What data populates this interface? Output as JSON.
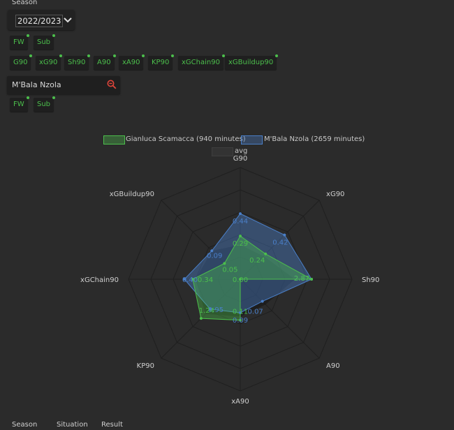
{
  "controls": {
    "season_label": "Season",
    "season_value": "2022/2023",
    "position_filters": [
      {
        "label": "FW"
      },
      {
        "label": "Sub"
      }
    ],
    "metric_filters": [
      {
        "label": "G90"
      },
      {
        "label": "xG90"
      },
      {
        "label": "Sh90"
      },
      {
        "label": "A90"
      },
      {
        "label": "xA90"
      },
      {
        "label": "KP90"
      },
      {
        "label": "xGChain90"
      },
      {
        "label": "xGBuildup90"
      }
    ],
    "player_search_value": "M'Bala Nzola",
    "player_position_filters": [
      {
        "label": "FW"
      },
      {
        "label": "Sub"
      }
    ]
  },
  "colors": {
    "green": "#4cbf4c",
    "blue": "#4a7fc8"
  },
  "chart_data": {
    "type": "radar",
    "axes": [
      "G90",
      "xG90",
      "Sh90",
      "A90",
      "xA90",
      "KP90",
      "xGChain90",
      "xGBuildup90"
    ],
    "series": [
      {
        "name": "Gianluca Scamacca (940 minutes)",
        "color": "#4cbf4c",
        "values": [
          0.29,
          0.24,
          2.87,
          0.0,
          0.11,
          1.24,
          0.34,
          0.05
        ]
      },
      {
        "name": "M'Bala Nzola (2659 minutes)",
        "color": "#4a7fc8",
        "values": [
          0.44,
          0.42,
          2.87,
          0.07,
          0.09,
          0.95,
          0.4,
          0.09
        ]
      },
      {
        "name": "avg",
        "color": "#3a3a3a",
        "values": [
          0.23,
          0.22,
          2.2,
          0.08,
          0.1,
          1.1,
          0.32,
          0.09
        ]
      }
    ],
    "axis_max": [
      0.75,
      0.75,
      4.5,
      0.25,
      0.3,
      2.5,
      0.8,
      0.25
    ],
    "labels": {
      "green": [
        "0.29",
        "0.24",
        "2.87",
        "0.00",
        "0.11",
        "1.24",
        "0.34",
        "0.05"
      ],
      "blue": [
        "0.44",
        "0.42",
        "2.87",
        "0.07",
        "0.09",
        "0.95",
        "0.40",
        "0.09"
      ]
    },
    "grid_levels": 5
  },
  "footer": {
    "col1": "Season",
    "col2": "Situation",
    "col3": "Result"
  }
}
